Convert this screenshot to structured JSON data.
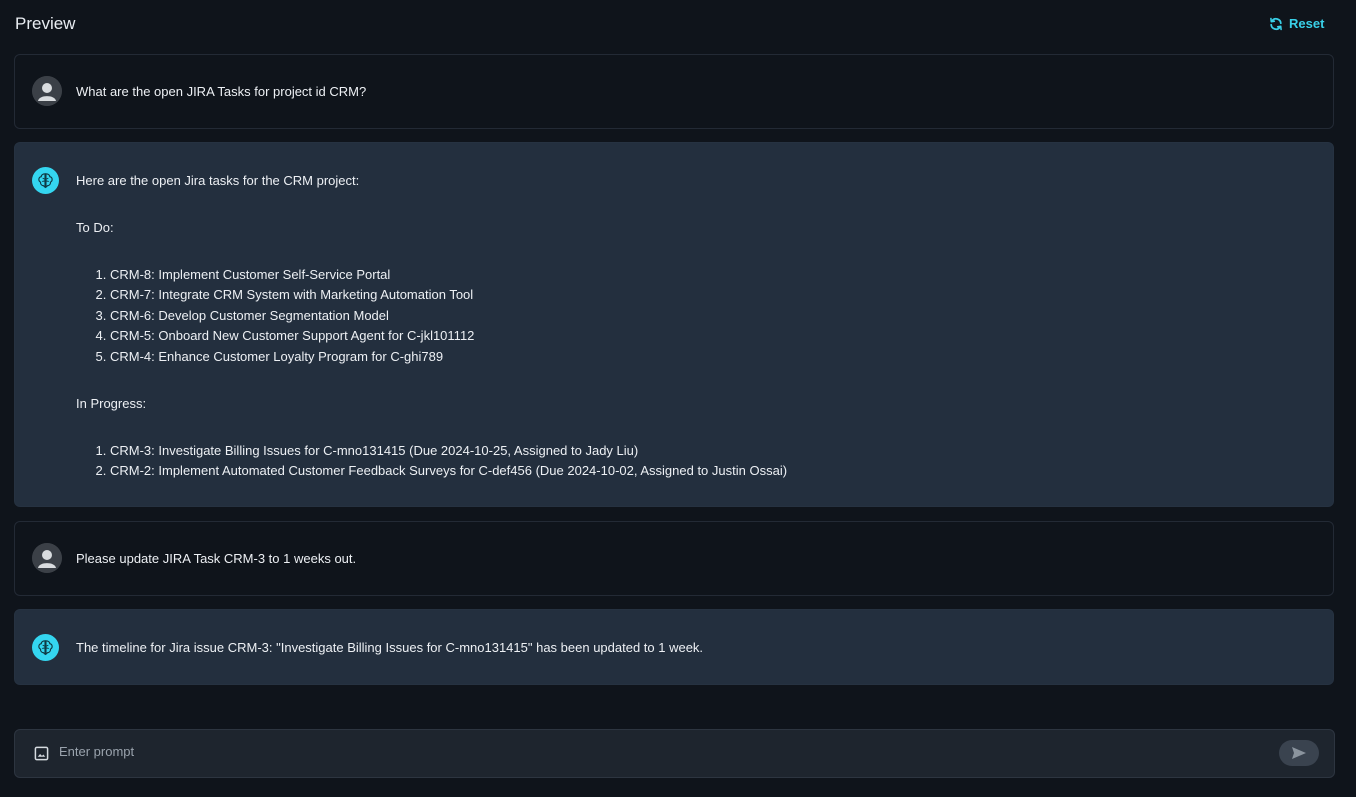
{
  "header": {
    "title": "Preview",
    "reset_label": "Reset"
  },
  "conversation": [
    {
      "role": "user",
      "text": "What are the open JIRA Tasks for project id CRM?"
    },
    {
      "role": "assistant",
      "intro": "Here are the open Jira tasks for the CRM project:",
      "todo_label": "To Do:",
      "todo_items": [
        "CRM-8: Implement Customer Self-Service Portal",
        "CRM-7: Integrate CRM System with Marketing Automation Tool",
        "CRM-6: Develop Customer Segmentation Model",
        "CRM-5: Onboard New Customer Support Agent for C-jkl101112",
        "CRM-4: Enhance Customer Loyalty Program for C-ghi789"
      ],
      "in_progress_label": "In Progress:",
      "in_progress_items": [
        "CRM-3: Investigate Billing Issues for C-mno131415 (Due 2024-10-25, Assigned to Jady Liu)",
        "CRM-2: Implement Automated Customer Feedback Surveys for C-def456 (Due 2024-10-02, Assigned to Justin Ossai)"
      ]
    },
    {
      "role": "user",
      "text": "Please update JIRA Task CRM-3 to 1 weeks out."
    },
    {
      "role": "assistant",
      "text": "The timeline for Jira issue CRM-3: \"Investigate Billing Issues for C-mno131415\" has been updated to 1 week."
    }
  ],
  "prompt": {
    "placeholder": "Enter prompt",
    "value": ""
  },
  "icons": {
    "reset": "refresh-icon",
    "user_avatar": "user-avatar-icon",
    "bot_avatar": "brain-icon",
    "attach": "image-icon",
    "send": "send-icon"
  },
  "colors": {
    "accent": "#39d0e8",
    "page_background": "#0f141b",
    "assistant_bubble": "#232f3e",
    "bot_avatar": "#34d6f0"
  }
}
